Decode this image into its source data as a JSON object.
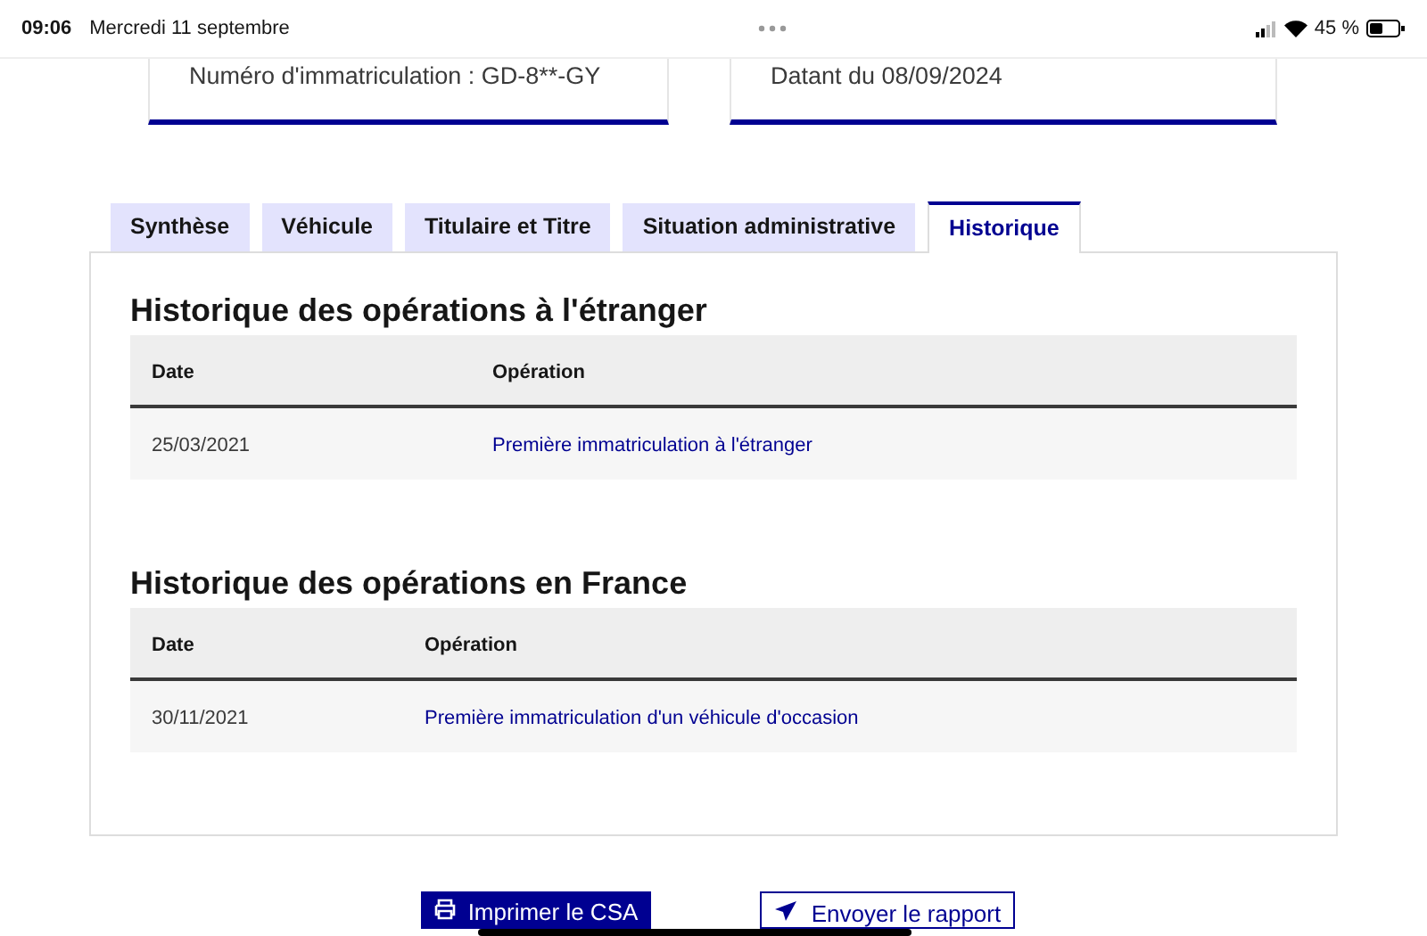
{
  "status_bar": {
    "time": "09:06",
    "date": "Mercredi 11 septembre",
    "battery": "45 %"
  },
  "cards": [
    {
      "text": "Numéro d'immatriculation : GD-8**-GY"
    },
    {
      "text": "Datant du 08/09/2024"
    }
  ],
  "tabs": [
    {
      "label": "Synthèse",
      "selected": false
    },
    {
      "label": "Véhicule",
      "selected": false
    },
    {
      "label": "Titulaire et Titre",
      "selected": false
    },
    {
      "label": "Situation administrative",
      "selected": false
    },
    {
      "label": "Historique",
      "selected": true
    }
  ],
  "sections": [
    {
      "title": "Historique des opérations à l'étranger",
      "columns": [
        "Date",
        "Opération"
      ],
      "rows": [
        [
          "25/03/2021",
          "Première immatriculation à l'étranger"
        ]
      ]
    },
    {
      "title": "Historique des opérations en France",
      "columns": [
        "Date",
        "Opération"
      ],
      "rows": [
        [
          "30/11/2021",
          "Première immatriculation d'un véhicule d'occasion"
        ]
      ]
    }
  ],
  "buttons": [
    {
      "label": "Imprimer le CSA",
      "kind": "primary"
    },
    {
      "label": "Envoyer le rapport",
      "kind": "secondary"
    }
  ]
}
